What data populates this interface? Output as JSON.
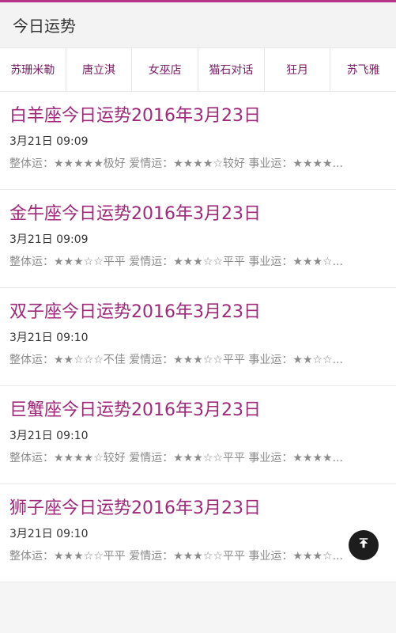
{
  "header": {
    "title": "今日运势"
  },
  "tabs": [
    "苏珊米勒",
    "唐立淇",
    "女巫店",
    "猫石对话",
    "狂月",
    "苏飞雅"
  ],
  "items": [
    {
      "title": "白羊座今日运势2016年3月23日",
      "time": "3月21日 09:09",
      "summary": "整体运：★★★★★极好 爱情运：★★★★☆较好 事业运：★★★★..."
    },
    {
      "title": "金牛座今日运势2016年3月23日",
      "time": "3月21日 09:09",
      "summary": "整体运：★★★☆☆平平 爱情运：★★★☆☆平平 事业运：★★★☆..."
    },
    {
      "title": "双子座今日运势2016年3月23日",
      "time": "3月21日 09:10",
      "summary": "整体运：★★☆☆☆不佳 爱情运：★★★☆☆平平 事业运：★★☆☆..."
    },
    {
      "title": "巨蟹座今日运势2016年3月23日",
      "time": "3月21日 09:10",
      "summary": "整体运：★★★★☆较好 爱情运：★★★☆☆平平 事业运：★★★★..."
    },
    {
      "title": "狮子座今日运势2016年3月23日",
      "time": "3月21日 09:10",
      "summary": "整体运：★★★☆☆平平 爱情运：★★★☆☆平平 事业运：★★★☆..."
    }
  ],
  "backtop": {
    "icon": "arrow-up-icon"
  },
  "colors": {
    "accent": "#b8338a",
    "title": "#a0287a"
  }
}
